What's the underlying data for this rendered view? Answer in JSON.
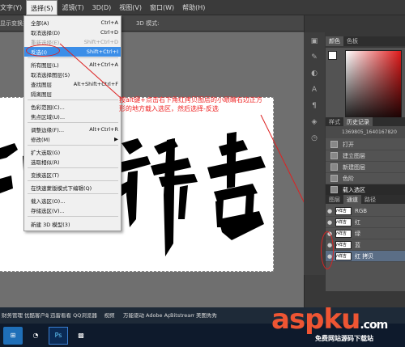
{
  "menubar": {
    "items": [
      "文字(Y)",
      "选择(S)",
      "滤镜(T)",
      "3D(D)",
      "视图(V)",
      "窗口(W)",
      "帮助(H)"
    ]
  },
  "options": {
    "label": "显示变换控件",
    "mode": "3D 模式:"
  },
  "select_menu": {
    "items": [
      {
        "label": "全部(A)",
        "shortcut": "Ctrl+A",
        "state": "normal"
      },
      {
        "label": "取消选择(D)",
        "shortcut": "Ctrl+D",
        "state": "normal"
      },
      {
        "label": "重新选择(E)",
        "shortcut": "Shift+Ctrl+D",
        "state": "disabled"
      },
      {
        "label": "反选(I)",
        "shortcut": "Shift+Ctrl+I",
        "state": "highlighted"
      },
      {
        "label": "所有图层(L)",
        "shortcut": "Alt+Ctrl+A",
        "state": "normal"
      },
      {
        "label": "取消选择图层(S)",
        "shortcut": "",
        "state": "normal"
      },
      {
        "label": "查找图层",
        "shortcut": "Alt+Shift+Ctrl+F",
        "state": "normal"
      },
      {
        "label": "隔离图层",
        "shortcut": "",
        "state": "normal"
      },
      {
        "label": "色彩范围(C)...",
        "shortcut": "",
        "state": "normal"
      },
      {
        "label": "焦点区域(U)...",
        "shortcut": "",
        "state": "normal"
      },
      {
        "label": "调整边缘(F)...",
        "shortcut": "Alt+Ctrl+R",
        "state": "normal"
      },
      {
        "label": "修改(M)",
        "shortcut": "▶",
        "state": "normal"
      },
      {
        "label": "扩大选取(G)",
        "shortcut": "",
        "state": "normal"
      },
      {
        "label": "选取相似(R)",
        "shortcut": "",
        "state": "normal"
      },
      {
        "label": "变换选区(T)",
        "shortcut": "",
        "state": "normal"
      },
      {
        "label": "在快速蒙版模式下编辑(Q)",
        "shortcut": "",
        "state": "normal"
      },
      {
        "label": "载入选区(O)...",
        "shortcut": "",
        "state": "normal"
      },
      {
        "label": "存储选区(V)...",
        "shortcut": "",
        "state": "normal"
      },
      {
        "label": "新建 3D 模型(3)",
        "shortcut": "",
        "state": "normal"
      }
    ]
  },
  "annotation": "按alt键+点击右下角红拷贝图层的小眼睛右边正方形的地方载入选区，然后选择-反选",
  "canvas": {
    "characters": [
      "示",
      "祥",
      "吉"
    ]
  },
  "color_panel": {
    "tabs": [
      "颜色",
      "色板"
    ],
    "accent": "#e01a1a"
  },
  "history_panel": {
    "tabs": [
      "样式",
      "历史记录"
    ],
    "snapshot": "1369805_1640167820",
    "rows": [
      "打开",
      "建立图层",
      "新建图层",
      "色阶",
      "载入选区"
    ],
    "active_row": 4
  },
  "layers_panel": {
    "tabs": [
      "图层",
      "通道",
      "路径"
    ],
    "rows": [
      {
        "name": "RGB",
        "thumb": "ሶ祥吉"
      },
      {
        "name": "红",
        "thumb": "ሶ祥吉"
      },
      {
        "name": "绿",
        "thumb": "ሶ祥吉"
      },
      {
        "name": "蓝",
        "thumb": "ሶ祥吉"
      },
      {
        "name": "红 拷贝",
        "thumb": "ሶ祥吉"
      }
    ],
    "active_row": 4
  },
  "taskbar_apps": [
    "财务管理",
    "优酷客户端",
    "迅雷看看",
    "QQ浏览器",
    "视频",
    "万能驱动",
    "Adobe Applic...",
    "Bitstream Font Nav...",
    "美图秀秀",
    "Adobe Photoshop",
    "360杀毒"
  ],
  "watermark": {
    "logo": "aspku",
    "tld": ".com",
    "sub": "免费网站源码下载站"
  }
}
